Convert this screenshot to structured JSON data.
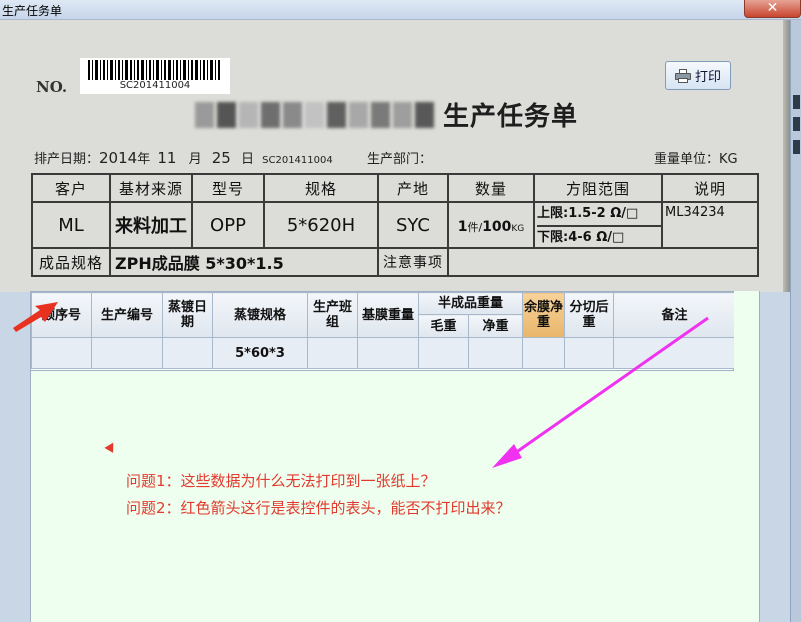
{
  "window": {
    "title": "生产任务单",
    "close_label": "✕"
  },
  "paper": {
    "no_label": "NO.",
    "barcode_text": "SC201411004",
    "title": "生产任务单",
    "print_button_label": "打印",
    "meta": {
      "schedule_date_label": "排产日期：",
      "year": "2014",
      "year_unit": "年",
      "month": "11",
      "month_unit": "月",
      "day": "25",
      "day_unit": "日",
      "order_code": "SC201411004",
      "department_label": "生产部门：",
      "weight_unit_label": "重量单位：KG"
    },
    "form": {
      "headers": [
        "客户",
        "基材来源",
        "型号",
        "规格",
        "产地",
        "数量",
        "方阻范围",
        "说明"
      ],
      "values": {
        "customer": "ML",
        "source": "来料加工",
        "model": "OPP",
        "spec": "5*620H",
        "origin": "SYC",
        "qty_count": "1",
        "qty_unit1": "件/",
        "qty_weight": "100",
        "qty_unit2": "KG",
        "upper_limit": "上限:1.5-2  Ω/□",
        "lower_limit": "下限:4-6    Ω/□",
        "note": "ML34234"
      },
      "product_spec_label": "成品规格",
      "product_spec_value": "ZPH成品膜  5*30*1.5",
      "attention_label": "注意事项"
    }
  },
  "grid": {
    "headers": {
      "seq": "顺序号",
      "prod_no": "生产编号",
      "vap_date": "蒸镀日期",
      "vap_spec": "蒸镀规格",
      "team": "生产班组",
      "base_weight": "基膜重量",
      "semi_group": "半成品重量",
      "gross": "毛重",
      "net": "净重",
      "remain": "余膜净重",
      "cut_weight": "分切后重",
      "remark": "备注"
    },
    "row": {
      "vap_spec": "5*60*3"
    }
  },
  "annotations": {
    "question1": "问题1：这些数据为什么无法打印到一张纸上？",
    "question2": "问题2：红色箭头这行是表控件的表头，能否不打印出来？",
    "colors": {
      "red_arrow": "#e8321f",
      "magenta_arrow": "#f032f0",
      "grid_bg": "#efffef"
    }
  }
}
